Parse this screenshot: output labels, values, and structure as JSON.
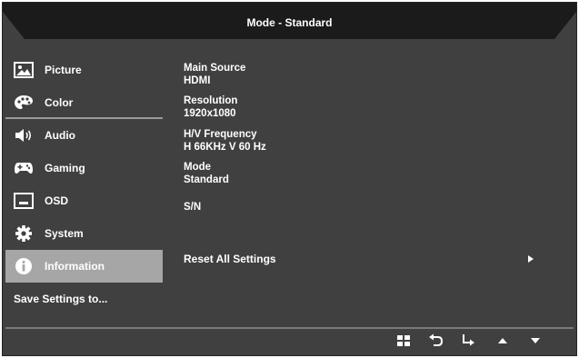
{
  "header": {
    "title": "Mode - Standard"
  },
  "sidebar": {
    "items": [
      {
        "label": "Picture",
        "icon": "picture-icon"
      },
      {
        "label": "Color",
        "icon": "palette-icon"
      },
      {
        "label": "Audio",
        "icon": "speaker-icon"
      },
      {
        "label": "Gaming",
        "icon": "gamepad-icon"
      },
      {
        "label": "OSD",
        "icon": "osd-icon"
      },
      {
        "label": "System",
        "icon": "gear-icon"
      },
      {
        "label": "Information",
        "icon": "info-icon",
        "selected": true
      }
    ],
    "save_label": "Save Settings to..."
  },
  "information": {
    "main_source_label": "Main Source",
    "main_source_value": "HDMI",
    "resolution_label": "Resolution",
    "resolution_value": "1920x1080",
    "frequency_label": "H/V Frequency",
    "frequency_value": "H 66KHz V 60 Hz",
    "mode_label": "Mode",
    "mode_value": "Standard",
    "sn_label": "S/N",
    "reset_label": "Reset All Settings"
  },
  "nav_buttons": [
    "menu-grid-icon",
    "back-icon",
    "enter-icon",
    "up-arrow-icon",
    "down-arrow-icon"
  ],
  "colors": {
    "background": "#404040",
    "header": "#1a1a1a",
    "selected": "#a6a6a6",
    "text": "#ffffff"
  }
}
